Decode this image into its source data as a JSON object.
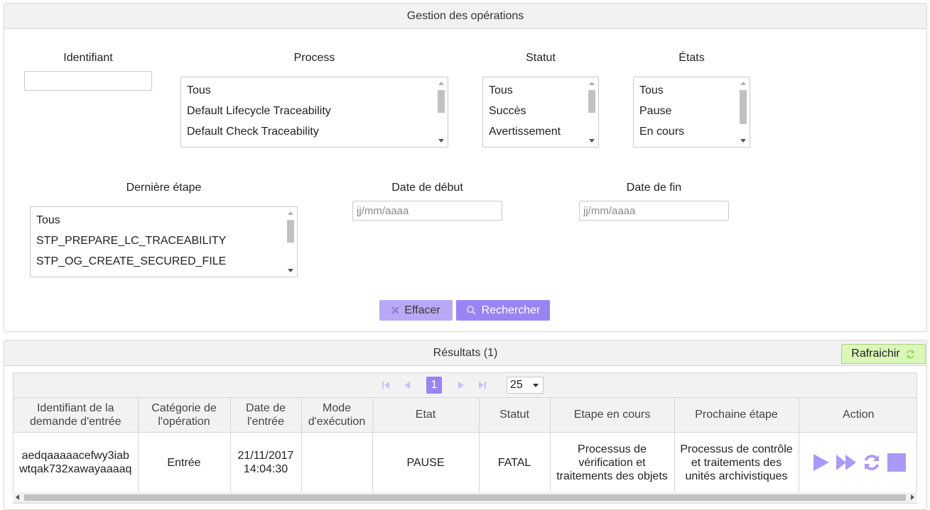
{
  "search": {
    "title": "Gestion des opérations",
    "identifier": {
      "label": "Identifiant",
      "value": ""
    },
    "process": {
      "label": "Process",
      "options": [
        "Tous",
        "Default Lifecycle Traceability",
        "Default Check Traceability"
      ]
    },
    "status": {
      "label": "Statut",
      "options": [
        "Tous",
        "Succès",
        "Avertissement"
      ]
    },
    "states": {
      "label": "États",
      "options": [
        "Tous",
        "Pause",
        "En cours"
      ]
    },
    "last_step": {
      "label": "Dernière étape",
      "options": [
        "Tous",
        "STP_PREPARE_LC_TRACEABILITY",
        "STP_OG_CREATE_SECURED_FILE"
      ]
    },
    "start_date": {
      "label": "Date de début",
      "placeholder": "jj/mm/aaaa"
    },
    "end_date": {
      "label": "Date de fin",
      "placeholder": "jj/mm/aaaa"
    },
    "clear_label": "Effacer",
    "search_label": "Rechercher"
  },
  "results": {
    "title": "Résultats (1)",
    "refresh_label": "Rafraichir",
    "paginator": {
      "current_page": "1",
      "page_size": "25"
    },
    "columns": [
      "Identifiant de la demande d'entrée",
      "Catégorie de l'opération",
      "Date de l'entrée",
      "Mode d'exécution",
      "Etat",
      "Statut",
      "Etape en cours",
      "Prochaine étape",
      "Action"
    ],
    "rows": [
      {
        "id": "aedqaaaaacefwy3iabwtqak732xawayaaaaq",
        "category": "Entrée",
        "date": "21/11/2017 14:04:30",
        "mode": "",
        "state": "PAUSE",
        "status": "FATAL",
        "current_step": "Processus de vérification et traitements des objets",
        "next_step": "Processus de contrôle et traitements des unités archivistiques"
      }
    ]
  },
  "colors": {
    "accent": "#9a84f4",
    "accent_light": "#b9a8f5",
    "refresh_bg": "#d9f7b6"
  },
  "icons": [
    "clear-icon",
    "search-icon",
    "refresh-icon",
    "first-page-icon",
    "prev-page-icon",
    "next-page-icon",
    "last-page-icon",
    "play-icon",
    "fast-forward-icon",
    "replay-icon",
    "stop-icon"
  ]
}
